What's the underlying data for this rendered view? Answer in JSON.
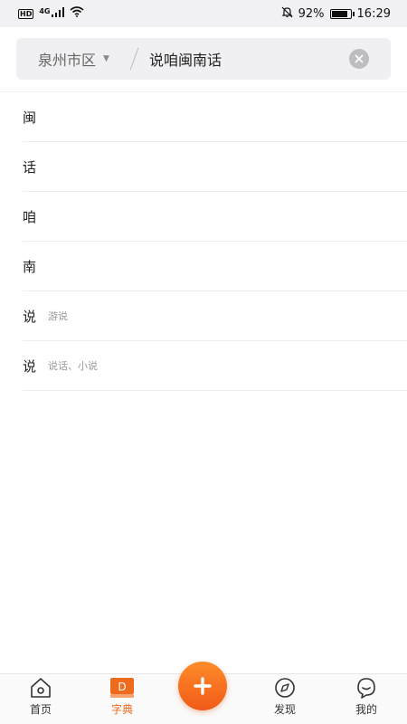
{
  "status_bar": {
    "hd": "HD",
    "network": "4G",
    "battery_text": "92%",
    "battery_level": 0.92,
    "time": "16:29"
  },
  "search": {
    "region": "泉州市区",
    "query": "说咱闽南话"
  },
  "results": [
    {
      "char": "闽",
      "sub": ""
    },
    {
      "char": "话",
      "sub": ""
    },
    {
      "char": "咱",
      "sub": ""
    },
    {
      "char": "南",
      "sub": ""
    },
    {
      "char": "说",
      "sub": "游说"
    },
    {
      "char": "说",
      "sub": "说话、小说"
    }
  ],
  "nav": {
    "home": "首页",
    "dictionary": "字典",
    "discover": "发现",
    "mine": "我的",
    "dictionary_badge": "D"
  },
  "colors": {
    "accent": "#f06a1e",
    "fab_top": "#ff8c2a",
    "fab_bottom": "#f05a17"
  }
}
